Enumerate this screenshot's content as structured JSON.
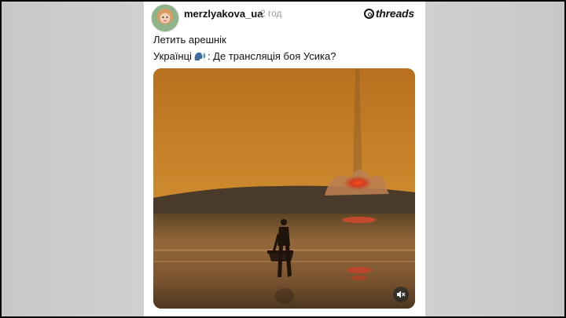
{
  "post": {
    "username": "merzlyakova_ua",
    "timestamp": "2 год",
    "brand": "threads",
    "line1": "Летить арешнік",
    "line2_prefix": "Українці",
    "line2_suffix": ": Де трансляція боя Усика?",
    "emoji": "speaking-head-icon"
  },
  "media": {
    "type": "video",
    "mute_icon": "muted-speaker-icon",
    "sky_color": "#c9862a",
    "sea_color": "#7a5228"
  }
}
